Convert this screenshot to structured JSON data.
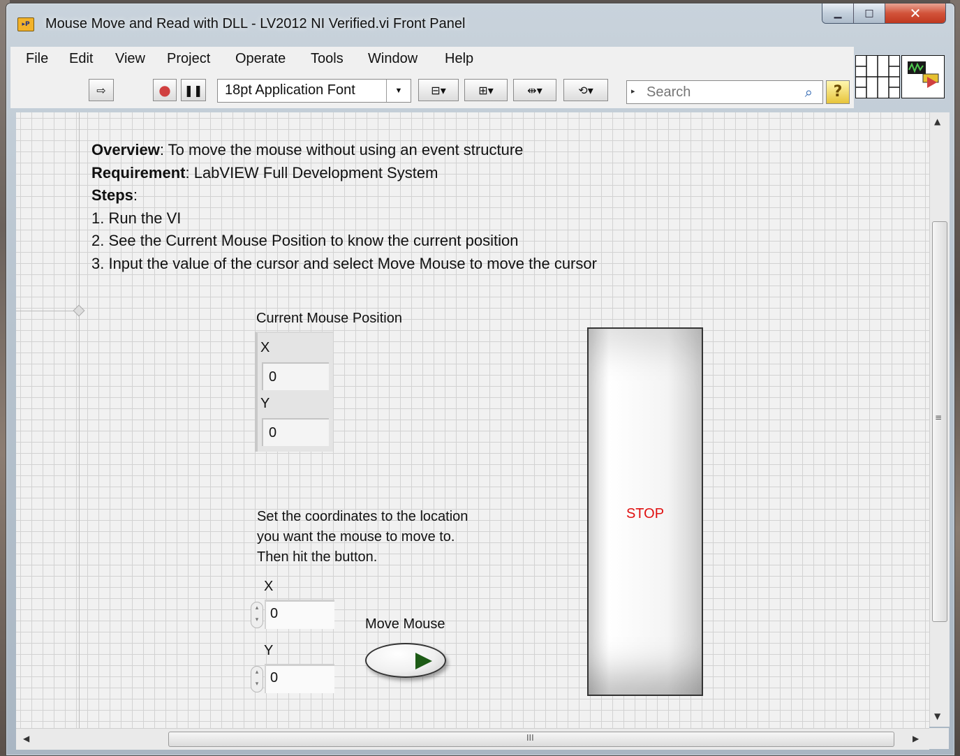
{
  "window": {
    "title": "Mouse Move and Read with DLL - LV2012 NI Verified.vi Front Panel",
    "icon_label": "▸P",
    "caption_buttons": {
      "minimize": "▁",
      "maximize": "□",
      "close": "✕"
    }
  },
  "menubar": {
    "items": [
      "File",
      "Edit",
      "View",
      "Project",
      "Operate",
      "Tools",
      "Window",
      "Help"
    ]
  },
  "toolbar": {
    "run_icon": "⇨",
    "abort_icon": "●",
    "pause_icon": "❚❚",
    "font": "18pt Application Font",
    "align_icon": "⊟▾",
    "distribute_icon": "⊞▾",
    "resize_icon": "⇹▾",
    "reorder_icon": "⟲▾",
    "search_placeholder": "Search",
    "help_icon": "?"
  },
  "panel": {
    "overview_label": "Overview",
    "overview_text": ": To move the mouse without using an event structure",
    "requirement_label": "Requirement",
    "requirement_text": ": LabVIEW Full Development System",
    "steps_label": "Steps",
    "steps_colon": ":",
    "steps": [
      "1. Run the VI",
      "2. See the Current Mouse Position to know the current position",
      "3. Input the value of the cursor and select Move Mouse to move the cursor"
    ],
    "current_position": {
      "label": "Current Mouse Position",
      "x_label": "X",
      "x_value": "0",
      "y_label": "Y",
      "y_value": "0"
    },
    "instructions": [
      "Set the coordinates to the location",
      "you want the mouse to move to.",
      "Then hit the button."
    ],
    "set_x_label": "X",
    "set_x_value": "0",
    "set_y_label": "Y",
    "set_y_value": "0",
    "move_button_label": "Move Mouse",
    "stop_button_label": "STOP"
  },
  "scrollbars": {
    "up": "▲",
    "down": "▼",
    "left": "◀",
    "right": "▶",
    "v_grip": "≡",
    "h_grip": "III"
  }
}
